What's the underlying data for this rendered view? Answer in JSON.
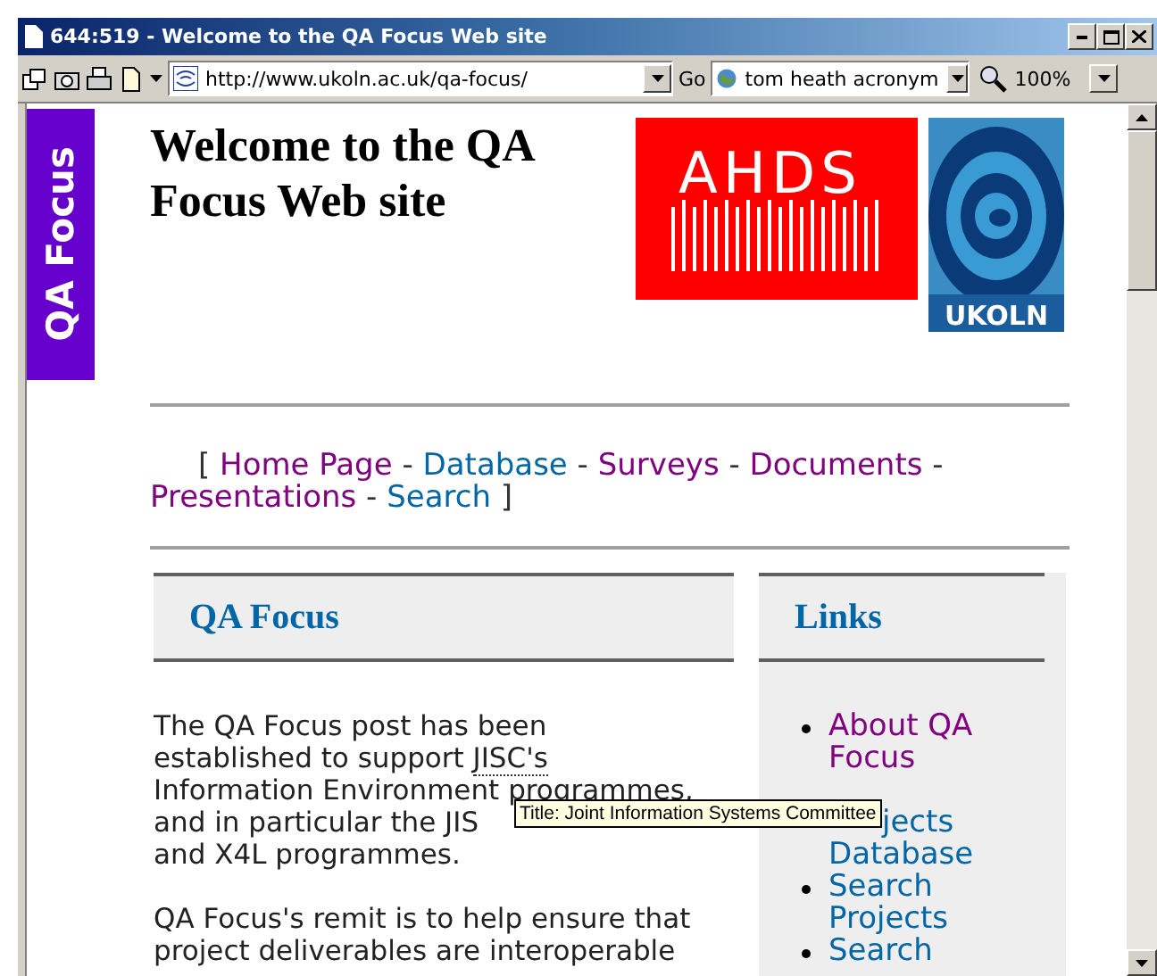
{
  "window": {
    "title": "644:519 - Welcome to the QA Focus Web site"
  },
  "toolbar": {
    "address": "http://www.ukoln.ac.uk/qa-focus/",
    "go": "Go",
    "search": "tom heath acronym",
    "zoom": "100%"
  },
  "banner": {
    "text": "QA Focus"
  },
  "page": {
    "title": "Welcome to the QA Focus Web site",
    "logos": [
      {
        "kind": "ahds",
        "text": "AHDS"
      },
      {
        "kind": "ukoln",
        "text": "UKOLN"
      }
    ],
    "nav": {
      "open": "[",
      "close": "]",
      "separator": "-",
      "links": [
        {
          "label": "Home Page",
          "visited": true
        },
        {
          "label": "Database",
          "visited": false
        },
        {
          "label": "Surveys",
          "visited": true
        },
        {
          "label": "Documents",
          "visited": true
        },
        {
          "label": "Presentations",
          "visited": true
        },
        {
          "label": "Search",
          "visited": false
        }
      ]
    },
    "main": {
      "heading": "QA Focus",
      "paragraphs": [
        {
          "lines": [
            {
              "text": "The QA Focus post has been"
            },
            {
              "text": "established to support ",
              "abbr": "JISC's"
            },
            {
              "text": "Information Environment ",
              "underlined": "programmes,"
            },
            {
              "text": "and in particular the JIS"
            },
            {
              "text": "and X4L programmes."
            }
          ]
        },
        {
          "lines": [
            {
              "text": "QA Focus's remit is to help ensure that"
            },
            {
              "text": "project deliverables are interoperable"
            }
          ]
        }
      ]
    },
    "links": {
      "heading": "Links",
      "items": [
        {
          "kind": "link",
          "lines": [
            "About QA Focus"
          ],
          "visited": true
        },
        {
          "kind": "covered",
          "lines": [
            "jects",
            "Database"
          ],
          "visited": false
        },
        {
          "kind": "link",
          "lines": [
            "Search Projects"
          ],
          "visited": false
        },
        {
          "kind": "link",
          "lines": [
            "Search"
          ],
          "visited": false
        }
      ]
    },
    "tooltip": {
      "text": "Title: Joint Information Systems Committee"
    }
  }
}
